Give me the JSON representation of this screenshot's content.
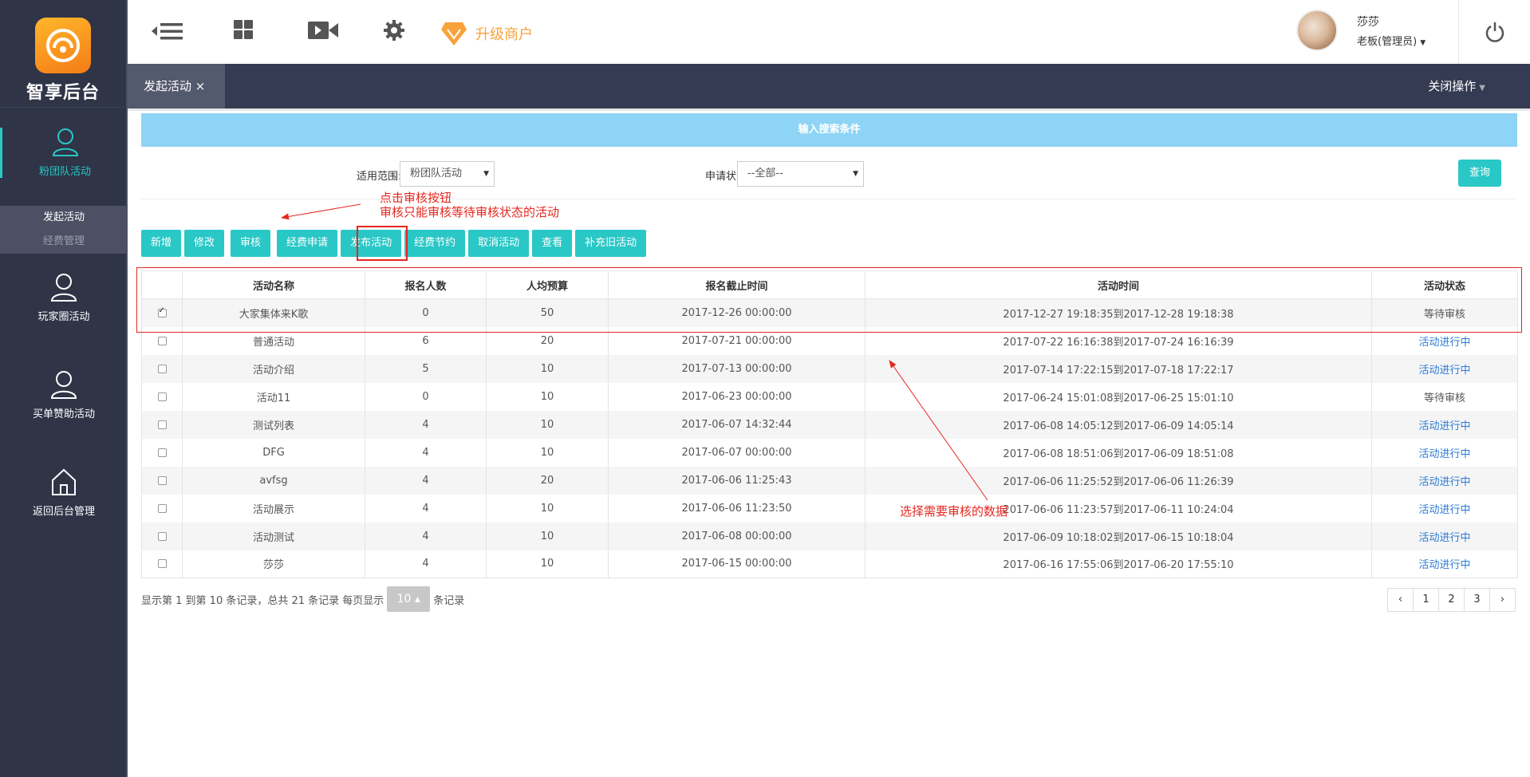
{
  "brand": {
    "name": "智享后台",
    "logo_color": "#f7941d"
  },
  "sidebar": {
    "items": [
      {
        "label": "粉团队活动",
        "icon": "user-icon",
        "active": true
      },
      {
        "label": "玩家圈活动",
        "icon": "user-icon"
      },
      {
        "label": "买单赞助活动",
        "icon": "user-icon"
      },
      {
        "label": "返回后台管理",
        "icon": "home-icon"
      }
    ],
    "submenu": [
      "发起活动",
      "经费管理"
    ]
  },
  "topbar": {
    "icons": [
      "menu-collapse-icon",
      "grid-icon",
      "video-icon",
      "gear-icon"
    ],
    "upgrade_label": "升级商户",
    "user_name": "莎莎",
    "user_role": "老板(管理员)"
  },
  "tabs": {
    "active_tab": "发起活动 ×",
    "close_ops": "关闭操作"
  },
  "search": {
    "header": "输入搜索条件",
    "scope_label": "适用范围:",
    "scope_value": "粉团队活动",
    "status_label": "申请状态:",
    "status_value": "--全部--",
    "query_button": "查询"
  },
  "toolbar": [
    "新增",
    "修改",
    "审核",
    "经费申请",
    "发布活动",
    "经费节约",
    "取消活动",
    "查看",
    "补充旧活动"
  ],
  "annotations": {
    "a1_line1": "点击审核按钮",
    "a1_line2": "审核只能审核等待审核状态的活动",
    "a2": "选择需要审核的数据"
  },
  "table": {
    "headers": [
      "",
      "活动名称",
      "报名人数",
      "人均预算",
      "报名截止时间",
      "活动时间",
      "活动状态"
    ],
    "rows": [
      {
        "checked": true,
        "name": "大家集体来K歌",
        "count": "0",
        "budget": "50",
        "deadline": "2017-12-26 00:00:00",
        "time": "2017-12-27 19:18:35到2017-12-28 19:18:38",
        "status": "等待审核"
      },
      {
        "checked": false,
        "name": "普通活动",
        "count": "6",
        "budget": "20",
        "deadline": "2017-07-21 00:00:00",
        "time": "2017-07-22 16:16:38到2017-07-24 16:16:39",
        "status": "活动进行中"
      },
      {
        "checked": false,
        "name": "活动介绍",
        "count": "5",
        "budget": "10",
        "deadline": "2017-07-13 00:00:00",
        "time": "2017-07-14 17:22:15到2017-07-18 17:22:17",
        "status": "活动进行中"
      },
      {
        "checked": false,
        "name": "活动11",
        "count": "0",
        "budget": "10",
        "deadline": "2017-06-23 00:00:00",
        "time": "2017-06-24 15:01:08到2017-06-25 15:01:10",
        "status": "等待审核"
      },
      {
        "checked": false,
        "name": "测试列表",
        "count": "4",
        "budget": "10",
        "deadline": "2017-06-07 14:32:44",
        "time": "2017-06-08 14:05:12到2017-06-09 14:05:14",
        "status": "活动进行中"
      },
      {
        "checked": false,
        "name": "DFG",
        "count": "4",
        "budget": "10",
        "deadline": "2017-06-07 00:00:00",
        "time": "2017-06-08 18:51:06到2017-06-09 18:51:08",
        "status": "活动进行中"
      },
      {
        "checked": false,
        "name": "avfsg",
        "count": "4",
        "budget": "20",
        "deadline": "2017-06-06 11:25:43",
        "time": "2017-06-06 11:25:52到2017-06-06 11:26:39",
        "status": "活动进行中"
      },
      {
        "checked": false,
        "name": "活动展示",
        "count": "4",
        "budget": "10",
        "deadline": "2017-06-06 11:23:50",
        "time": "2017-06-06 11:23:57到2017-06-11 10:24:04",
        "status": "活动进行中"
      },
      {
        "checked": false,
        "name": "活动测试",
        "count": "4",
        "budget": "10",
        "deadline": "2017-06-08 00:00:00",
        "time": "2017-06-09 10:18:02到2017-06-15 10:18:04",
        "status": "活动进行中"
      },
      {
        "checked": false,
        "name": "莎莎",
        "count": "4",
        "budget": "10",
        "deadline": "2017-06-15 00:00:00",
        "time": "2017-06-16 17:55:06到2017-06-20 17:55:10",
        "status": "活动进行中"
      }
    ]
  },
  "pager": {
    "info_before": "显示第 1 到第 10 条记录，总共 21 条记录 每页显示",
    "page_size": "10 ▴",
    "info_after": "条记录",
    "pages": [
      "‹",
      "1",
      "2",
      "3",
      "›"
    ]
  },
  "colors": {
    "accent": "#29c7c6",
    "sidebar_bg": "#2f3447",
    "annotation": "#e5271f",
    "status_running": "#2b7ad6"
  }
}
